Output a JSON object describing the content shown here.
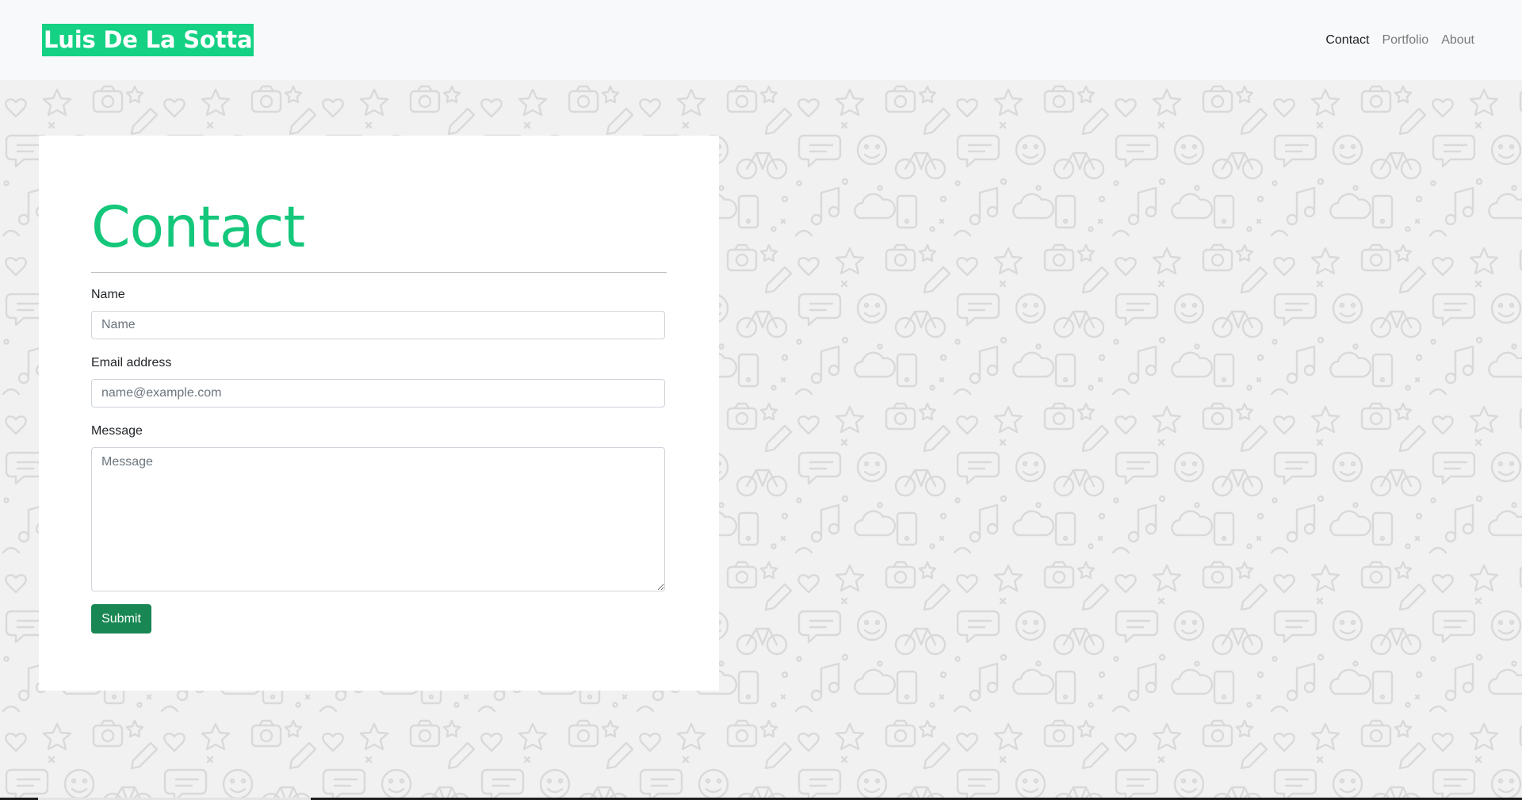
{
  "brand": {
    "title": "Luis De La Sotta",
    "color": "#14d183"
  },
  "nav": {
    "items": [
      {
        "label": "Contact",
        "active": true
      },
      {
        "label": "Portfolio",
        "active": false
      },
      {
        "label": "About",
        "active": false
      }
    ]
  },
  "contact": {
    "title": "Contact",
    "title_color": "#14c77b",
    "name": {
      "label": "Name",
      "placeholder": "Name",
      "value": ""
    },
    "email": {
      "label": "Email address",
      "placeholder": "name@example.com",
      "value": ""
    },
    "message": {
      "label": "Message",
      "placeholder": "Message",
      "value": ""
    },
    "submit_label": "Submit",
    "submit_color": "#198754"
  },
  "background": {
    "pattern": "doodle-pattern",
    "color": "#f1f1f1"
  }
}
